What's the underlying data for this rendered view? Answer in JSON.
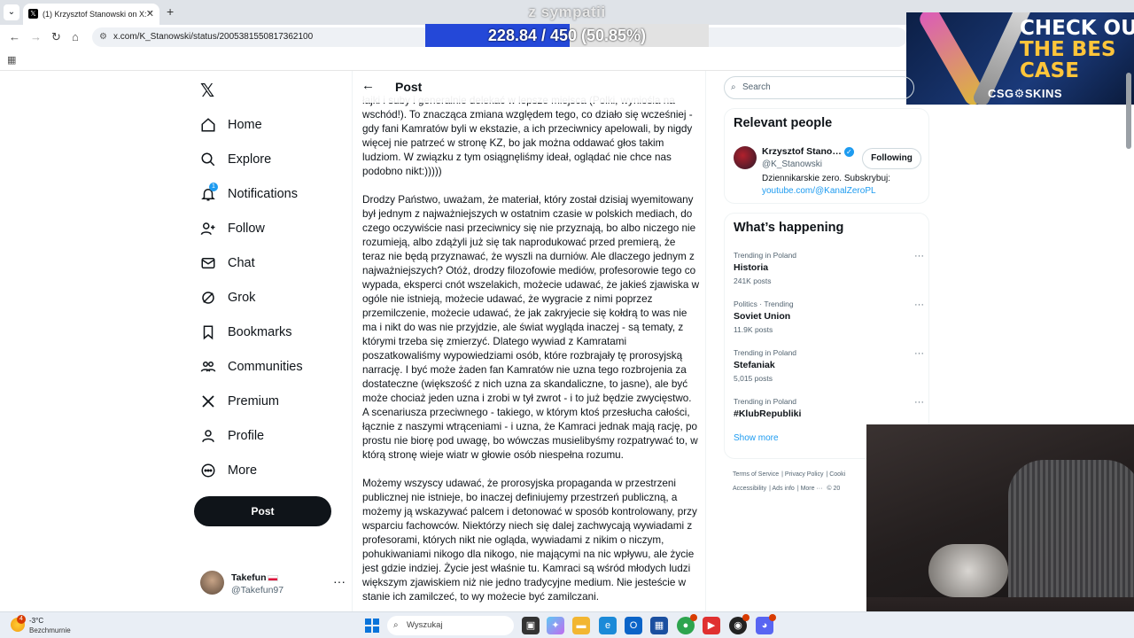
{
  "browser": {
    "tab_title": "(1) Krzysztof Stanowski on X: \"",
    "url": "x.com/K_Stanowski/status/2005381550817362100"
  },
  "overlay": {
    "label": "z sympatii",
    "progress_text": "228.84 / 450 (50.85%)",
    "progress_fraction": 0.5085,
    "fill_color": "#2448d8"
  },
  "ad": {
    "line1": "CHECK OU",
    "line2": "THE BES",
    "line3": "CASE",
    "brand": "CSG⚙SKINS"
  },
  "nav": {
    "items": [
      {
        "label": "Home",
        "icon": "home-icon"
      },
      {
        "label": "Explore",
        "icon": "search-icon"
      },
      {
        "label": "Notifications",
        "icon": "bell-icon",
        "badge": "1"
      },
      {
        "label": "Follow",
        "icon": "person-plus-icon"
      },
      {
        "label": "Chat",
        "icon": "envelope-icon"
      },
      {
        "label": "Grok",
        "icon": "grok-icon"
      },
      {
        "label": "Bookmarks",
        "icon": "bookmark-icon"
      },
      {
        "label": "Communities",
        "icon": "people-icon"
      },
      {
        "label": "Premium",
        "icon": "x-icon"
      },
      {
        "label": "Profile",
        "icon": "person-icon"
      },
      {
        "label": "More",
        "icon": "more-circle-icon"
      }
    ],
    "post_button": "Post",
    "account": {
      "name": "Takefun",
      "handle": "@Takefun97",
      "more": "···"
    }
  },
  "post": {
    "header": "Post",
    "paragraphs": [
      "łajki i suby i generalnie delekać w lepsze miejsca (Polki, wyniośla na wschód!). To znacząca zmiana względem tego, co działo się wcześniej - gdy fani Kamratów byli w ekstazie, a ich przeciwnicy apelowali, by nigdy więcej nie patrzeć w stronę KZ, bo jak można oddawać głos takim ludziom. W związku z tym osiągnęliśmy ideał, oglądać nie chce nas podobno nikt:)))))",
      "Drodzy Państwo, uważam, że materiał, który został dzisiaj wyemitowany był jednym z najważniejszych w ostatnim czasie w polskich mediach, do czego oczywiście nasi przeciwnicy się nie przyznają, bo albo niczego nie rozumieją, albo zdążyli już się tak naprodukować przed premierą, że teraz nie będą przyznawać, że wyszli na durniów. Ale dlaczego jednym z najważniejszych? Otóż, drodzy filozofowie mediów, profesorowie tego co wypada, eksperci cnót wszelakich, możecie udawać, że jakieś zjawiska w ogóle nie istnieją, możecie udawać, że wygracie z nimi poprzez przemilczenie, możecie udawać, że jak zakryjecie się kołdrą to was nie ma i nikt do was nie przyjdzie, ale świat wygląda inaczej - są tematy, z którymi trzeba się zmierzyć. Dlatego wywiad z Kamratami poszatkowaliśmy wypowiedziami osób, które rozbrajały tę prorosyjską narrację. I być może żaden fan Kamratów nie uzna tego rozbrojenia za dostateczne (większość z nich uzna za skandaliczne, to jasne), ale być może chociaż jeden uzna i zrobi w tył zwrot - i to już będzie zwycięstwo. A scenariusza przeciwnego - takiego, w którym ktoś przesłucha całości, łącznie z naszymi wtrąceniami - i uzna, że Kamraci jednak mają rację, po prostu nie biorę pod uwagę, bo wówczas musielibyśmy rozpatrywać to, w którą stronę wieje wiatr w głowie osób niespełna rozumu.",
      "Możemy wszyscy udawać, że prorosyjska propaganda w przestrzeni publicznej nie istnieje, bo inaczej definiujemy przestrzeń publiczną, a możemy ją wskazywać palcem i detonować w sposób kontrolowany, przy wsparciu fachowców. Niektórzy niech się dalej zachwycają wywiadami z profesorami, których nikt nie ogląda, wywiadami z nikim o niczym, pohukiwaniami nikogo dla nikogo, nie mającymi na nic wpływu, ale życie jest gdzie indziej. Życie jest właśnie tu. Kamraci są wśród młodych ludzi większym zjawiskiem niż nie jedno tradycyjne medium. Nie jesteście w stanie ich zamilczeć, to wy możecie być zamilczani."
    ]
  },
  "right": {
    "search_placeholder": "Search",
    "relevant_title": "Relevant people",
    "person": {
      "name": "Krzysztof Stano…",
      "handle": "@K_Stanowski",
      "follow_label": "Following",
      "bio": "Dziennikarskie zero. Subskrybuj:",
      "link": "youtube.com/@KanalZeroPL"
    },
    "happening_title": "What’s happening",
    "trends": [
      {
        "meta": "Trending in Poland",
        "name": "Historia",
        "count": "241K posts"
      },
      {
        "meta": "Politics · Trending",
        "name": "Soviet Union",
        "count": "11.9K posts"
      },
      {
        "meta": "Trending in Poland",
        "name": "Stefaniak",
        "count": "5,015 posts"
      },
      {
        "meta": "Trending in Poland",
        "name": "#KlubRepubliki",
        "count": ""
      }
    ],
    "show_more": "Show more",
    "footer": {
      "terms": "Terms of Service",
      "privacy": "Privacy Policy",
      "cookie": "Cooki",
      "accessibility": "Accessibility",
      "ads": "Ads info",
      "more": "More ···",
      "copy": "© 20"
    }
  },
  "taskbar": {
    "temp": "-3°C",
    "condition": "Bezchmurnie",
    "weather_badge": "4",
    "search_placeholder": "Wyszukaj"
  }
}
